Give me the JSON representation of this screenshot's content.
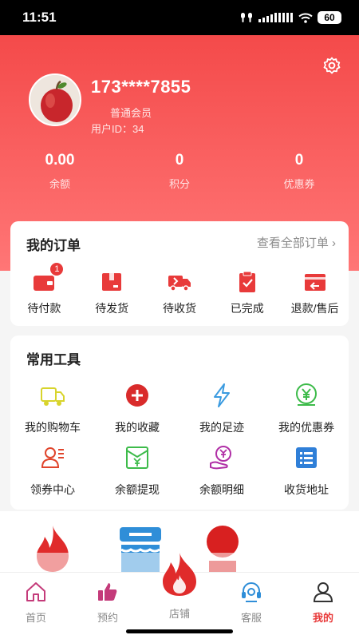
{
  "status": {
    "time": "11:51",
    "battery": "60"
  },
  "profile": {
    "username": "173****7855",
    "member_level": "普通会员",
    "uid_label": "用户ID：",
    "uid": "34"
  },
  "stats": [
    {
      "value": "0.00",
      "label": "余额"
    },
    {
      "value": "0",
      "label": "积分"
    },
    {
      "value": "0",
      "label": "优惠券"
    }
  ],
  "orders": {
    "title": "我的订单",
    "view_all": "查看全部订单",
    "items": [
      {
        "label": "待付款",
        "badge": "1",
        "icon": "wallet-icon"
      },
      {
        "label": "待发货",
        "icon": "box-icon"
      },
      {
        "label": "待收货",
        "icon": "truck-icon"
      },
      {
        "label": "已完成",
        "icon": "clipboard-check-icon"
      },
      {
        "label": "退款/售后",
        "icon": "refund-icon"
      }
    ]
  },
  "tools": {
    "title": "常用工具",
    "items": [
      {
        "label": "我的购物车",
        "icon": "cart-truck-icon"
      },
      {
        "label": "我的收藏",
        "icon": "plus-circle-icon"
      },
      {
        "label": "我的足迹",
        "icon": "lightning-icon"
      },
      {
        "label": "我的优惠券",
        "icon": "yuan-coupon-icon"
      },
      {
        "label": "领券中心",
        "icon": "person-list-icon"
      },
      {
        "label": "余额提现",
        "icon": "envelope-yuan-icon"
      },
      {
        "label": "余额明细",
        "icon": "hand-yuan-icon"
      },
      {
        "label": "收货地址",
        "icon": "list-icon"
      }
    ]
  },
  "nav": [
    {
      "label": "首页",
      "icon": "home-icon"
    },
    {
      "label": "预约",
      "icon": "thumbs-up-icon"
    },
    {
      "label": "店铺",
      "icon": "fire-icon"
    },
    {
      "label": "客服",
      "icon": "headset-icon"
    },
    {
      "label": "我的",
      "icon": "person-icon",
      "active": true
    }
  ],
  "colors": {
    "primary": "#e83a3a",
    "header_top": "#f44a4a",
    "header_bottom": "#ff7676"
  }
}
